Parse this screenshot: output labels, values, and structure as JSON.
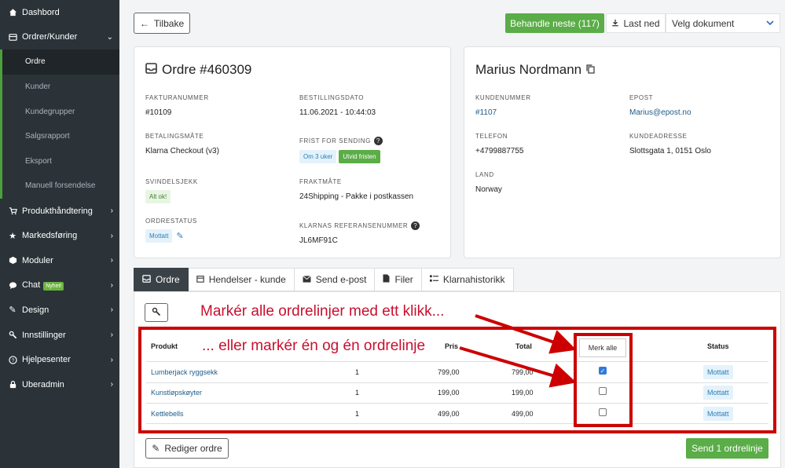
{
  "sidebar": {
    "items": [
      {
        "label": "Dashbord",
        "icon": "home-icon"
      },
      {
        "label": "Ordrer/Kunder",
        "icon": "list-icon"
      },
      {
        "label": "Produkthåndtering",
        "icon": "cart-icon"
      },
      {
        "label": "Markedsføring",
        "icon": "star-icon"
      },
      {
        "label": "Moduler",
        "icon": "cube-icon"
      },
      {
        "label": "Chat",
        "icon": "chat-icon",
        "badge": "Nyhet!"
      },
      {
        "label": "Design",
        "icon": "pencil-icon"
      },
      {
        "label": "Innstillinger",
        "icon": "wrench-icon"
      },
      {
        "label": "Hjelpesenter",
        "icon": "help-icon"
      },
      {
        "label": "Uberadmin",
        "icon": "lock-icon"
      }
    ],
    "sub_items": [
      "Ordre",
      "Kunder",
      "Kundegrupper",
      "Salgsrapport",
      "Eksport",
      "Manuell forsendelse"
    ]
  },
  "topbar": {
    "back": "Tilbake",
    "next": "Behandle neste (117)",
    "download": "Last ned",
    "select_doc": "Velg dokument"
  },
  "order": {
    "title": "Ordre #460309",
    "invoice_label": "FAKTURANUMMER",
    "invoice": "#10109",
    "date_label": "BESTILLINGSDATO",
    "date": "11.06.2021 - 10:44:03",
    "payment_label": "BETALINGSMÅTE",
    "payment": "Klarna Checkout (v3)",
    "deadline_label": "FRIST FOR SENDING",
    "deadline": "Om 3 uker",
    "extend": "Utvid fristen",
    "fraud_label": "SVINDELSJEKK",
    "fraud": "Alt ok!",
    "shipping_label": "FRAKTMÅTE",
    "shipping": "24Shipping - Pakke i postkassen",
    "status_label": "ORDRESTATUS",
    "status": "Mottatt",
    "klarna_label": "KLARNAS REFERANSENUMMER",
    "klarna": "JL6MF91C"
  },
  "customer": {
    "name": "Marius Nordmann",
    "number_label": "KUNDENUMMER",
    "number": "#1107",
    "email_label": "EPOST",
    "email": "Marius@epost.no",
    "phone_label": "TELEFON",
    "phone": "+4799887755",
    "address_label": "KUNDEADRESSE",
    "address": "Slottsgata 1, 0151 Oslo",
    "country_label": "LAND",
    "country": "Norway"
  },
  "tabs": [
    "Ordre",
    "Hendelser - kunde",
    "Send e-post",
    "Filer",
    "Klarnahistorikk"
  ],
  "table": {
    "headers": {
      "product": "Produkt",
      "price": "Pris",
      "total": "Total",
      "status": "Status"
    },
    "mark_all": "Merk alle",
    "rows": [
      {
        "product": "Lumberjack ryggsekk",
        "qty": "1",
        "price": "799,00",
        "total": "799,00",
        "status": "Mottatt",
        "checked": true
      },
      {
        "product": "Kunstløpskøyter",
        "qty": "1",
        "price": "199,00",
        "total": "199,00",
        "status": "Mottatt",
        "checked": false
      },
      {
        "product": "Kettlebells",
        "qty": "1",
        "price": "499,00",
        "total": "499,00",
        "status": "Mottatt",
        "checked": false
      }
    ]
  },
  "annotations": {
    "line1": "Markér alle ordrelinjer med ett klikk...",
    "line2": "... eller markér én og én ordrelinje"
  },
  "actions": {
    "edit": "Rediger ordre",
    "send": "Send 1 ordrelinje"
  },
  "colors": {
    "green": "#5aad47",
    "sidebar": "#2b3338",
    "annotation_red": "#cc0000",
    "link": "#1d5c87"
  }
}
